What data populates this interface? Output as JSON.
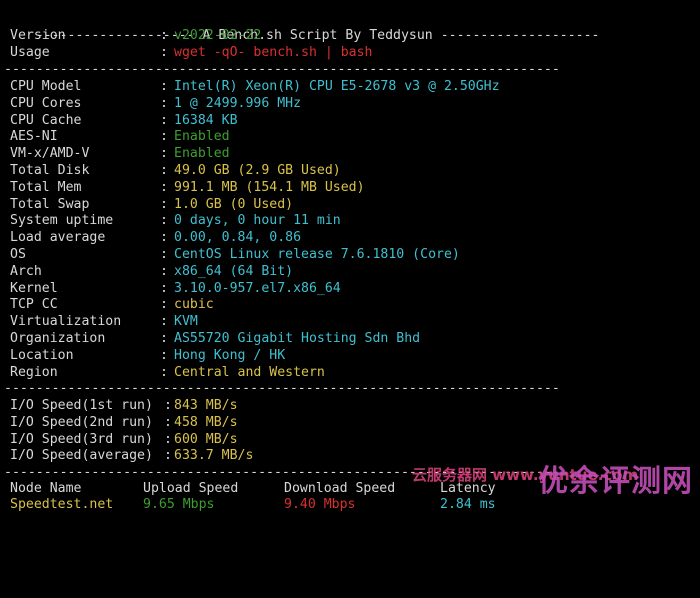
{
  "header_title": "A Bench.sh Script By Teddysun",
  "version": {
    "label": "Version",
    "value": "v2022-02-22"
  },
  "usage": {
    "label": "Usage",
    "value": "wget -qO- bench.sh | bash"
  },
  "system": [
    {
      "label": "CPU Model",
      "value": "Intel(R) Xeon(R) CPU E5-2678 v3 @ 2.50GHz",
      "color": "cyan"
    },
    {
      "label": "CPU Cores",
      "value": "1 @ 2499.996 MHz",
      "color": "cyan"
    },
    {
      "label": "CPU Cache",
      "value": "16384 KB",
      "color": "cyan"
    },
    {
      "label": "AES-NI",
      "value": "Enabled",
      "color": "green"
    },
    {
      "label": "VM-x/AMD-V",
      "value": "Enabled",
      "color": "green"
    },
    {
      "label": "Total Disk",
      "value": "49.0 GB (2.9 GB Used)",
      "color": "yellow"
    },
    {
      "label": "Total Mem",
      "value": "991.1 MB (154.1 MB Used)",
      "color": "yellow"
    },
    {
      "label": "Total Swap",
      "value": "1.0 GB (0 Used)",
      "color": "yellow"
    },
    {
      "label": "System uptime",
      "value": "0 days, 0 hour 11 min",
      "color": "cyan"
    },
    {
      "label": "Load average",
      "value": "0.00, 0.84, 0.86",
      "color": "cyan"
    },
    {
      "label": "OS",
      "value": "CentOS Linux release 7.6.1810 (Core)",
      "color": "cyan"
    },
    {
      "label": "Arch",
      "value": "x86_64 (64 Bit)",
      "color": "cyan"
    },
    {
      "label": "Kernel",
      "value": "3.10.0-957.el7.x86_64",
      "color": "cyan"
    },
    {
      "label": "TCP CC",
      "value": "cubic",
      "color": "yellow"
    },
    {
      "label": "Virtualization",
      "value": "KVM",
      "color": "cyan"
    },
    {
      "label": "Organization",
      "value": "AS55720 Gigabit Hosting Sdn Bhd",
      "color": "cyan"
    },
    {
      "label": "Location",
      "value": "Hong Kong / HK",
      "color": "cyan"
    },
    {
      "label": "Region",
      "value": "Central and Western",
      "color": "yellow"
    }
  ],
  "io": [
    {
      "label": "I/O Speed(1st run)",
      "value": "843 MB/s"
    },
    {
      "label": "I/O Speed(2nd run)",
      "value": "458 MB/s"
    },
    {
      "label": "I/O Speed(3rd run)",
      "value": "600 MB/s"
    },
    {
      "label": "I/O Speed(average)",
      "value": "633.7 MB/s"
    }
  ],
  "speed_headers": {
    "node": "Node Name",
    "upload": "Upload Speed",
    "download": "Download Speed",
    "latency": "Latency"
  },
  "speed_rows": [
    {
      "node": "Speedtest.net",
      "upload": "9.65 Mbps",
      "download": "9.40 Mbps",
      "latency": "2.84 ms"
    }
  ],
  "watermark": {
    "small": "云服务器网 www.yuntue.com",
    "large": "优余评测网"
  },
  "colors": {
    "green": "#3e9e30",
    "red": "#d8312d",
    "yellow": "#d9c24a",
    "cyan": "#3fc0d0",
    "white": "#d8d8d8",
    "background": "#000000"
  }
}
